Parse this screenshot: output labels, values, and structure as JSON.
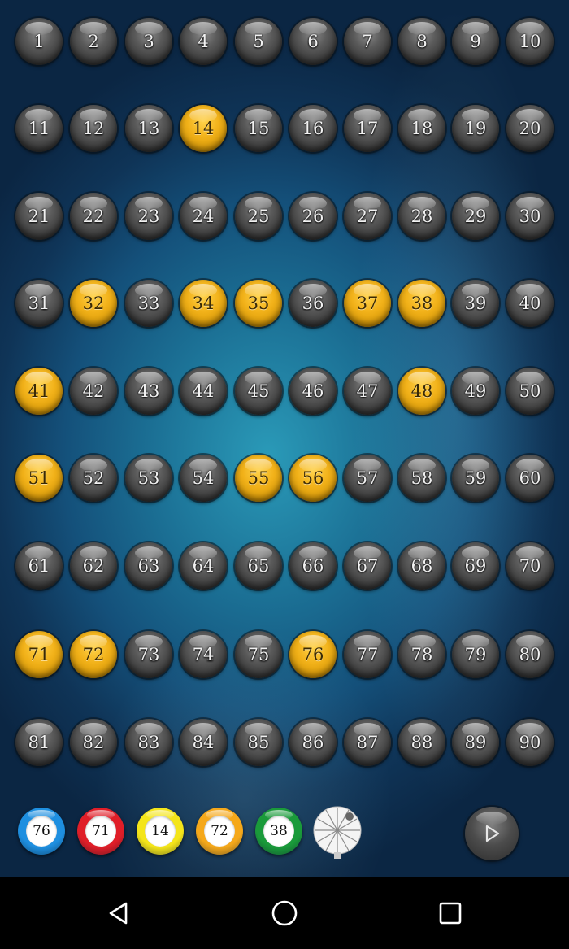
{
  "board": {
    "numbers": [
      1,
      2,
      3,
      4,
      5,
      6,
      7,
      8,
      9,
      10,
      11,
      12,
      13,
      14,
      15,
      16,
      17,
      18,
      19,
      20,
      21,
      22,
      23,
      24,
      25,
      26,
      27,
      28,
      29,
      30,
      31,
      32,
      33,
      34,
      35,
      36,
      37,
      38,
      39,
      40,
      41,
      42,
      43,
      44,
      45,
      46,
      47,
      48,
      49,
      50,
      51,
      52,
      53,
      54,
      55,
      56,
      57,
      58,
      59,
      60,
      61,
      62,
      63,
      64,
      65,
      66,
      67,
      68,
      69,
      70,
      71,
      72,
      73,
      74,
      75,
      76,
      77,
      78,
      79,
      80,
      81,
      82,
      83,
      84,
      85,
      86,
      87,
      88,
      89,
      90
    ],
    "called": [
      14,
      32,
      34,
      35,
      37,
      38,
      41,
      48,
      51,
      55,
      56,
      71,
      72,
      76
    ],
    "colors": {
      "uncalled": "#4a4a4a",
      "called": "#f2b21a"
    }
  },
  "recent_draws": [
    {
      "number": "76",
      "color": "#1e8fe0"
    },
    {
      "number": "71",
      "color": "#e01e28"
    },
    {
      "number": "14",
      "color": "#f4e51a"
    },
    {
      "number": "72",
      "color": "#f5a81a"
    },
    {
      "number": "38",
      "color": "#1a9a3a"
    }
  ],
  "controls": {
    "spinner_icon": "lottery-drum-icon",
    "play_icon": "play-icon"
  },
  "navbar": {
    "back_icon": "back-triangle-icon",
    "home_icon": "home-circle-icon",
    "recents_icon": "recents-square-icon"
  }
}
